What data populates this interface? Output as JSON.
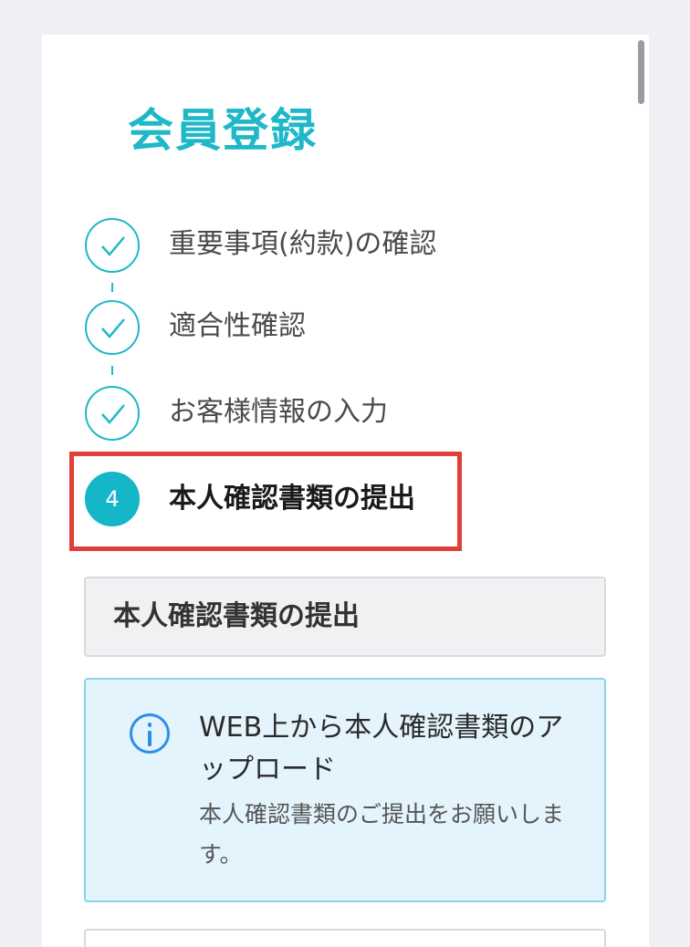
{
  "page": {
    "title": "会員登録"
  },
  "steps": [
    {
      "label": "重要事項(約款)の確認",
      "status": "completed",
      "icon": "check-icon"
    },
    {
      "label": "適合性確認",
      "status": "completed",
      "icon": "check-icon"
    },
    {
      "label": "お客様情報の入力",
      "status": "completed",
      "icon": "check-icon"
    },
    {
      "label": "本人確認書類の提出",
      "status": "current",
      "number": "4"
    }
  ],
  "section": {
    "header": "本人確認書類の提出"
  },
  "info": {
    "icon": "info-icon",
    "title": "WEB上から本人確認書類のアップロード",
    "body": "本人確認書類のご提出をお願いします。"
  },
  "colors": {
    "accent": "#1fb8c8",
    "highlight": "#df3f36",
    "info_background": "#e4f4fc",
    "info_icon": "#2b8fe6"
  }
}
